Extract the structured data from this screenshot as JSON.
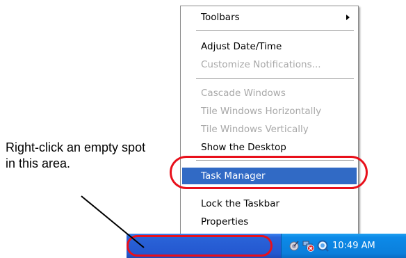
{
  "context_menu": {
    "items": [
      {
        "label": "Toolbars",
        "state": "normal",
        "has_submenu": true
      },
      {
        "label": "Adjust Date/Time",
        "state": "normal"
      },
      {
        "label": "Customize Notifications...",
        "state": "disabled"
      },
      {
        "label": "Cascade Windows",
        "state": "disabled"
      },
      {
        "label": "Tile Windows Horizontally",
        "state": "disabled"
      },
      {
        "label": "Tile Windows Vertically",
        "state": "disabled"
      },
      {
        "label": "Show the Desktop",
        "state": "normal"
      },
      {
        "label": "Task Manager",
        "state": "selected"
      },
      {
        "label": "Lock the Taskbar",
        "state": "normal"
      },
      {
        "label": "Properties",
        "state": "normal"
      }
    ]
  },
  "taskbar": {
    "clock": "10:49 AM",
    "tray_icons": [
      "satellite-dish-icon",
      "network-warning-icon",
      "search-icon"
    ]
  },
  "callout": {
    "text": "Right-click an empty spot in this area."
  },
  "colors": {
    "highlight_ring": "#e8101b",
    "menu_selection": "#316ac5",
    "taskbar_blue": "#2458d0",
    "tray_blue": "#0b7fdc"
  }
}
